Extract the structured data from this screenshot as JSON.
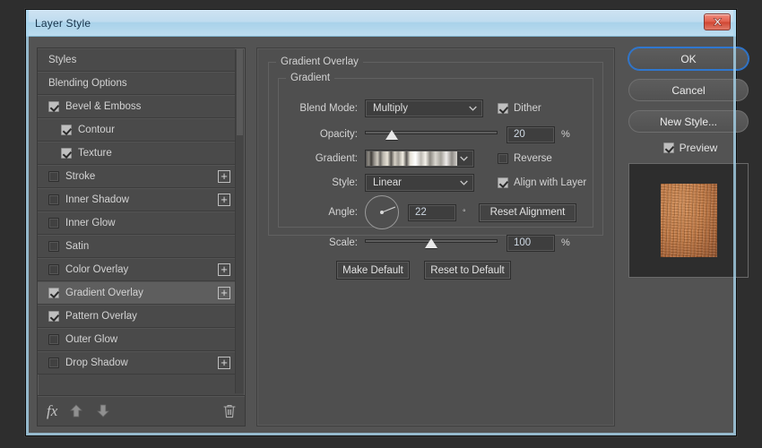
{
  "window": {
    "title": "Layer Style",
    "close_icon": "close-icon"
  },
  "styles_panel": {
    "items": [
      {
        "label": "Styles",
        "checkbox": "none",
        "indent": false,
        "selected": false,
        "plus": false
      },
      {
        "label": "Blending Options",
        "checkbox": "none",
        "indent": false,
        "selected": false,
        "plus": false
      },
      {
        "label": "Bevel & Emboss",
        "checkbox": "checked",
        "indent": false,
        "selected": false,
        "plus": false
      },
      {
        "label": "Contour",
        "checkbox": "checked",
        "indent": true,
        "selected": false,
        "plus": false
      },
      {
        "label": "Texture",
        "checkbox": "checked",
        "indent": true,
        "selected": false,
        "plus": false
      },
      {
        "label": "Stroke",
        "checkbox": "unchecked",
        "indent": false,
        "selected": false,
        "plus": true
      },
      {
        "label": "Inner Shadow",
        "checkbox": "unchecked",
        "indent": false,
        "selected": false,
        "plus": true
      },
      {
        "label": "Inner Glow",
        "checkbox": "unchecked",
        "indent": false,
        "selected": false,
        "plus": false
      },
      {
        "label": "Satin",
        "checkbox": "unchecked",
        "indent": false,
        "selected": false,
        "plus": false
      },
      {
        "label": "Color Overlay",
        "checkbox": "unchecked",
        "indent": false,
        "selected": false,
        "plus": true
      },
      {
        "label": "Gradient Overlay",
        "checkbox": "checked",
        "indent": false,
        "selected": true,
        "plus": true
      },
      {
        "label": "Pattern Overlay",
        "checkbox": "checked",
        "indent": false,
        "selected": false,
        "plus": false
      },
      {
        "label": "Outer Glow",
        "checkbox": "unchecked",
        "indent": false,
        "selected": false,
        "plus": false
      },
      {
        "label": "Drop Shadow",
        "checkbox": "unchecked",
        "indent": false,
        "selected": false,
        "plus": true
      }
    ],
    "toolbar": {
      "fx_label": "fx",
      "fx_icon": "fx-icon",
      "move_up_icon": "arrow-up-icon",
      "move_down_icon": "arrow-down-icon",
      "delete_icon": "trash-icon"
    }
  },
  "center_panel": {
    "section_title": "Gradient Overlay",
    "group_title": "Gradient",
    "blend_mode": {
      "label": "Blend Mode:",
      "value": "Multiply"
    },
    "dither": {
      "label": "Dither",
      "checked": true
    },
    "opacity": {
      "label": "Opacity:",
      "value": "20",
      "unit": "%",
      "percent": 20,
      "min": 0,
      "max": 100
    },
    "gradient": {
      "label": "Gradient:",
      "value": ""
    },
    "reverse": {
      "label": "Reverse",
      "checked": false
    },
    "style": {
      "label": "Style:",
      "value": "Linear"
    },
    "align_with_layer": {
      "label": "Align with Layer",
      "checked": true
    },
    "angle": {
      "label": "Angle:",
      "value": "22",
      "unit": "°"
    },
    "reset_alignment": {
      "label": "Reset Alignment"
    },
    "scale": {
      "label": "Scale:",
      "value": "100",
      "unit": "%",
      "percent": 50,
      "min": 0,
      "max": 200
    },
    "make_default": {
      "label": "Make Default"
    },
    "reset_to_default": {
      "label": "Reset to Default"
    }
  },
  "right_column": {
    "ok": {
      "label": "OK",
      "focused": true
    },
    "cancel": {
      "label": "Cancel"
    },
    "new_style": {
      "label": "New Style..."
    },
    "preview": {
      "label": "Preview",
      "checked": true
    }
  },
  "colors": {
    "accent_focus": "#2f77cf",
    "titlebar": "#bfdcef",
    "panel_bg": "#4f4f4f",
    "list_bg": "#4a4a4a",
    "selected_row": "#5e5e5e",
    "preview_swatch": "#c0763f"
  }
}
